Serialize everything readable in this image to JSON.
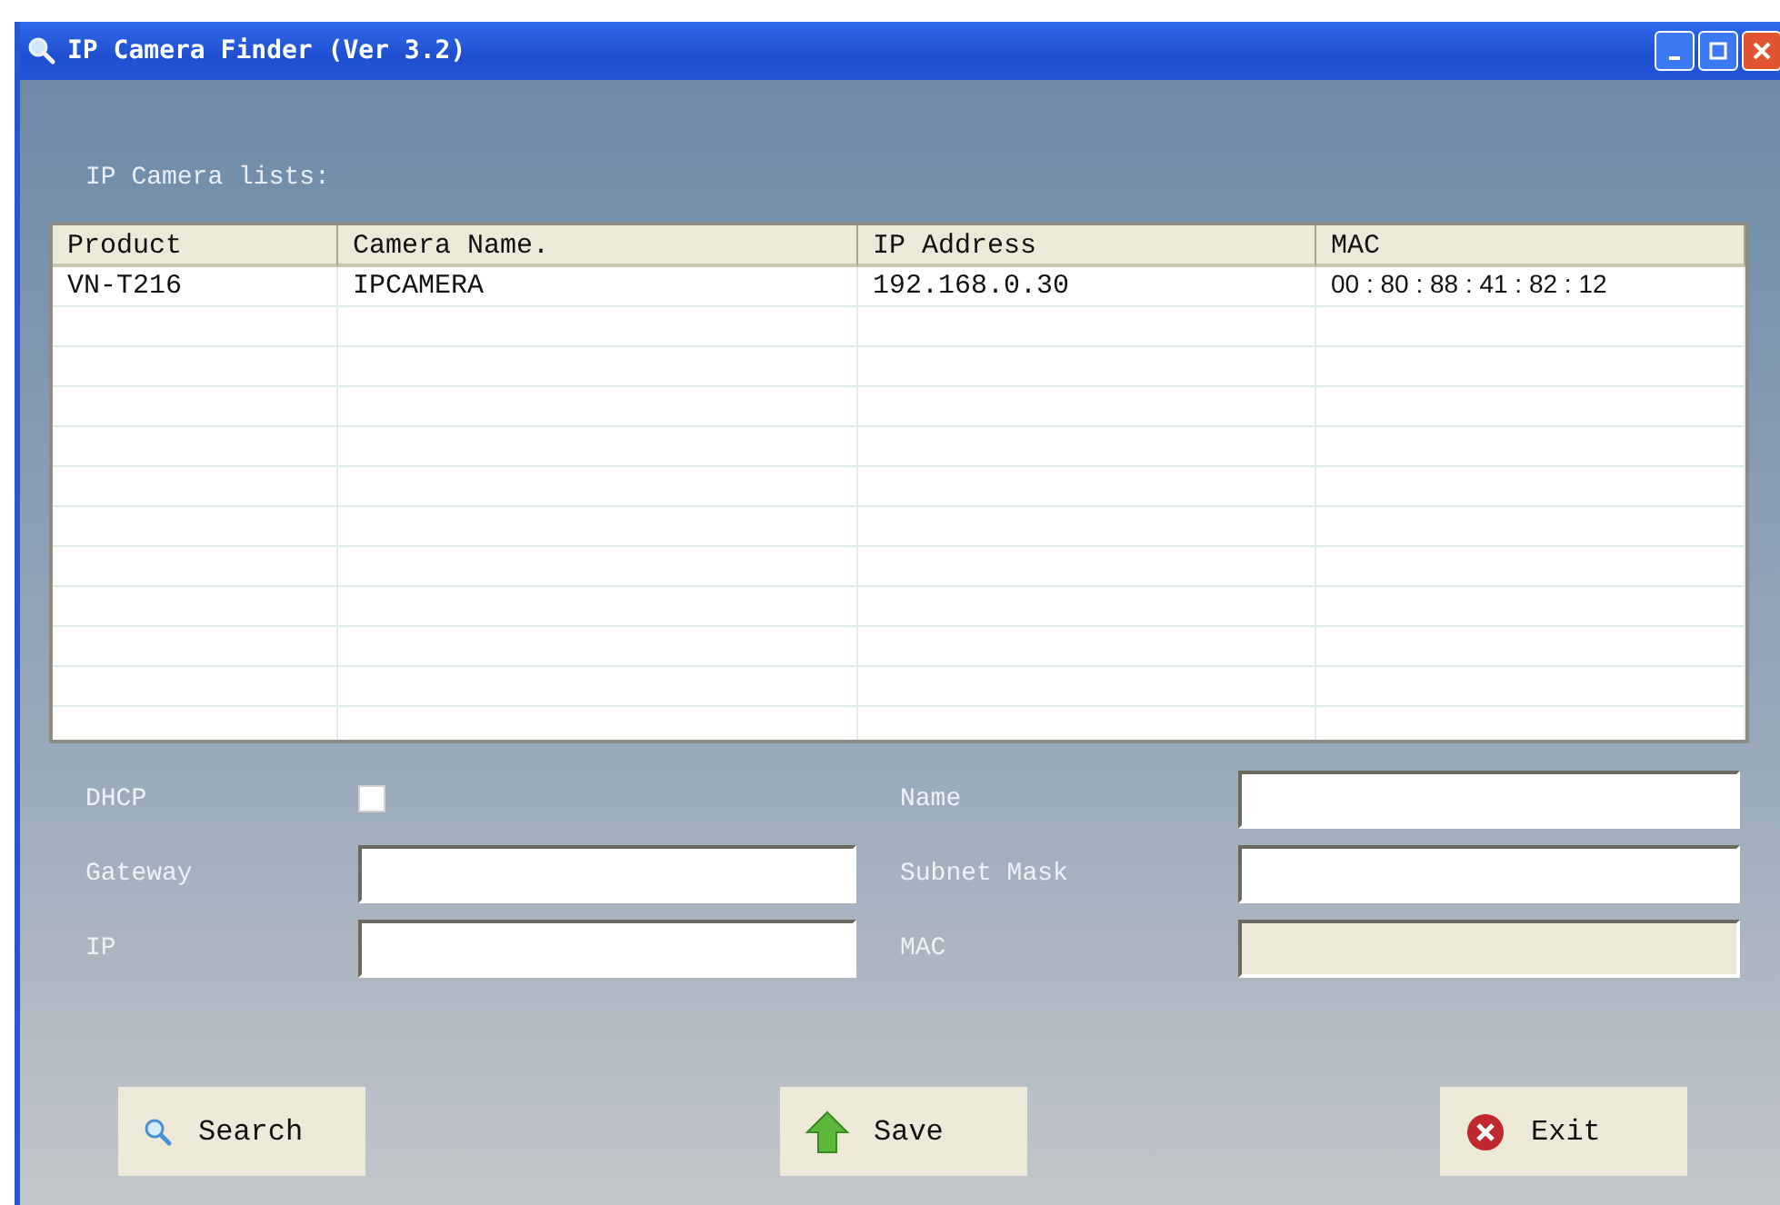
{
  "window": {
    "title": "IP Camera Finder (Ver 3.2)"
  },
  "list_label": "IP Camera lists:",
  "table": {
    "columns": [
      "Product",
      "Camera Name.",
      "IP Address",
      "MAC"
    ],
    "rows": [
      [
        "VN-T216",
        "IPCAMERA",
        "192.168.0.30",
        "00 : 80 : 88 : 41 : 82 : 12"
      ]
    ]
  },
  "left_fields": [
    {
      "label": "DHCP",
      "kind": "checkbox",
      "checked": false
    },
    {
      "label": "Gateway",
      "kind": "text",
      "disabled": false
    },
    {
      "label": "IP",
      "kind": "text",
      "disabled": false
    }
  ],
  "right_fields": [
    {
      "label": "Name",
      "kind": "text",
      "disabled": false
    },
    {
      "label": "Subnet Mask",
      "kind": "text",
      "disabled": false
    },
    {
      "label": "MAC",
      "kind": "text",
      "disabled": true
    }
  ],
  "buttons": [
    {
      "label": "Search",
      "kind": "search"
    },
    {
      "label": "Save",
      "kind": "save"
    },
    {
      "label": "Exit",
      "kind": "exit"
    }
  ]
}
